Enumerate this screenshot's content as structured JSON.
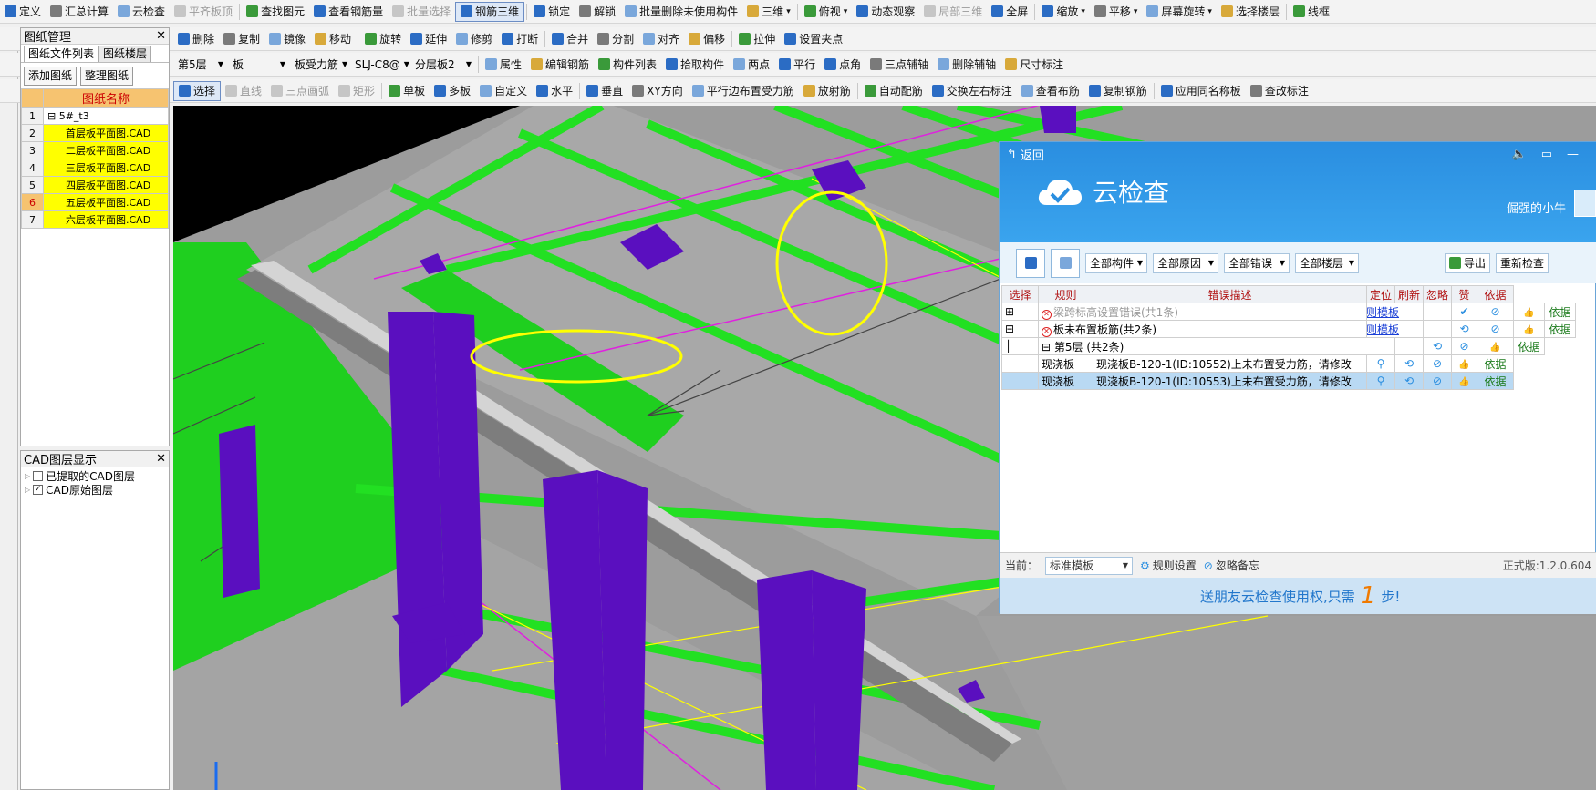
{
  "toolbar1": {
    "items": [
      {
        "icon": "define-icon",
        "label": "定义",
        "dis": false
      },
      {
        "icon": "sigma-icon",
        "label": "汇总计算",
        "dis": false
      },
      {
        "icon": "cloud-check-icon",
        "label": "云检查",
        "dis": false
      },
      {
        "icon": "align-top-icon",
        "label": "平齐板顶",
        "dis": true
      },
      {
        "icon": "binocular-icon",
        "label": "查找图元",
        "dis": false
      },
      {
        "icon": "view-rebar-icon",
        "label": "查看钢筋量",
        "dis": false
      },
      {
        "icon": "batch-select-icon",
        "label": "批量选择",
        "dis": true
      },
      {
        "icon": "rebar-3d-icon",
        "label": "钢筋三维",
        "dis": false,
        "on": true
      },
      {
        "icon": "lock-icon",
        "label": "锁定",
        "dis": false
      },
      {
        "icon": "unlock-icon",
        "label": "解锁",
        "dis": false
      },
      {
        "icon": "batch-delete-icon",
        "label": "批量删除未使用构件",
        "dis": false
      },
      {
        "icon": "3d-icon",
        "label": "三维",
        "dis": false,
        "caret": true
      },
      {
        "icon": "top-view-icon",
        "label": "俯视",
        "dis": false,
        "caret": true
      },
      {
        "icon": "orbit-icon",
        "label": "动态观察",
        "dis": false
      },
      {
        "icon": "local-3d-icon",
        "label": "局部三维",
        "dis": true
      },
      {
        "icon": "zoom-all-icon",
        "label": "全屏",
        "dis": false
      },
      {
        "icon": "zoom-icon",
        "label": "缩放",
        "dis": false,
        "caret": true
      },
      {
        "icon": "pan-icon",
        "label": "平移",
        "dis": false,
        "caret": true
      },
      {
        "icon": "rotate-screen-icon",
        "label": "屏幕旋转",
        "dis": false,
        "caret": true
      },
      {
        "icon": "select-floor-icon",
        "label": "选择楼层",
        "dis": false
      },
      {
        "icon": "wireframe-icon",
        "label": "线框",
        "dis": false
      }
    ]
  },
  "toolbar2": {
    "items": [
      {
        "icon": "delete-icon",
        "label": "删除"
      },
      {
        "icon": "copy-icon",
        "label": "复制"
      },
      {
        "icon": "mirror-icon",
        "label": "镜像"
      },
      {
        "icon": "move-icon",
        "label": "移动"
      },
      {
        "icon": "rotate-icon",
        "label": "旋转"
      },
      {
        "icon": "extend-icon",
        "label": "延伸"
      },
      {
        "icon": "trim-icon",
        "label": "修剪"
      },
      {
        "icon": "break-icon",
        "label": "打断"
      },
      {
        "icon": "merge-icon",
        "label": "合并"
      },
      {
        "icon": "split-icon",
        "label": "分割"
      },
      {
        "icon": "align-icon",
        "label": "对齐"
      },
      {
        "icon": "offset-icon",
        "label": "偏移"
      },
      {
        "icon": "stretch-icon",
        "label": "拉伸"
      },
      {
        "icon": "grip-icon",
        "label": "设置夹点"
      }
    ]
  },
  "toolbar3": {
    "selects": [
      "第5层",
      "板",
      "板受力筋",
      "SLJ-C8@",
      "分层板2"
    ],
    "items": [
      {
        "icon": "property-icon",
        "label": "属性"
      },
      {
        "icon": "edit-rebar-icon",
        "label": "编辑钢筋"
      },
      {
        "icon": "component-list-icon",
        "label": "构件列表"
      },
      {
        "icon": "pick-component-icon",
        "label": "拾取构件"
      },
      {
        "icon": "two-point-icon",
        "label": "两点"
      },
      {
        "icon": "parallel-icon",
        "label": "平行"
      },
      {
        "icon": "point-angle-icon",
        "label": "点角"
      },
      {
        "icon": "three-point-aux-icon",
        "label": "三点辅轴"
      },
      {
        "icon": "delete-aux-icon",
        "label": "删除辅轴"
      },
      {
        "icon": "dimension-icon",
        "label": "尺寸标注"
      }
    ]
  },
  "toolbar4": {
    "items": [
      {
        "icon": "select-icon",
        "label": "选择",
        "on": true
      },
      {
        "icon": "line-icon",
        "label": "直线",
        "dis": true
      },
      {
        "icon": "arc-icon",
        "label": "三点画弧",
        "dis": true
      },
      {
        "icon": "rect-icon",
        "label": "矩形",
        "dis": true
      },
      {
        "icon": "single-slab-icon",
        "label": "单板"
      },
      {
        "icon": "multi-slab-icon",
        "label": "多板"
      },
      {
        "icon": "custom-icon",
        "label": "自定义"
      },
      {
        "icon": "horizontal-icon",
        "label": "水平"
      },
      {
        "icon": "vertical-icon",
        "label": "垂直"
      },
      {
        "icon": "xy-direction-icon",
        "label": "XY方向"
      },
      {
        "icon": "parallel-edge-icon",
        "label": "平行边布置受力筋"
      },
      {
        "icon": "radial-icon",
        "label": "放射筋"
      },
      {
        "icon": "auto-rebar-icon",
        "label": "自动配筋"
      },
      {
        "icon": "swap-label-icon",
        "label": "交换左右标注"
      },
      {
        "icon": "view-layout-icon",
        "label": "查看布筋"
      },
      {
        "icon": "copy-rebar-icon",
        "label": "复制钢筋"
      },
      {
        "icon": "apply-same-icon",
        "label": "应用同名称板"
      },
      {
        "icon": "check-label-icon",
        "label": "查改标注"
      }
    ]
  },
  "drawing_panel": {
    "title": "图纸管理",
    "tabs": [
      "图纸文件列表",
      "图纸楼层"
    ],
    "add_btn": "添加图纸",
    "arrange_btn": "整理图纸",
    "col_header": "图纸名称",
    "rows": [
      {
        "n": "1",
        "name": "5#_t3",
        "yellow": false
      },
      {
        "n": "2",
        "name": "首层板平面图.CAD",
        "yellow": true
      },
      {
        "n": "3",
        "name": "二层板平面图.CAD",
        "yellow": true
      },
      {
        "n": "4",
        "name": "三层板平面图.CAD",
        "yellow": true
      },
      {
        "n": "5",
        "name": "四层板平面图.CAD",
        "yellow": true
      },
      {
        "n": "6",
        "name": "五层板平面图.CAD",
        "yellow": true
      },
      {
        "n": "7",
        "name": "六层板平面图.CAD",
        "yellow": true
      }
    ]
  },
  "layer_panel": {
    "title": "CAD图层显示",
    "items": [
      {
        "label": "已提取的CAD图层",
        "checked": false
      },
      {
        "label": "CAD原始图层",
        "checked": true
      }
    ]
  },
  "cloud": {
    "back": "返回",
    "title": "云检查",
    "user": "倔强的小牛",
    "filters": [
      "全部构件",
      "全部原因",
      "全部错误",
      "全部楼层"
    ],
    "export": "导出",
    "recheck": "重新检查",
    "headers": [
      "选择",
      "规则",
      "错误描述",
      "定位",
      "刷新",
      "忽略",
      "赞",
      "依据"
    ],
    "rows": [
      {
        "kind": "group",
        "expand": "+",
        "text": "梁跨标高设置错误(共1条)",
        "muted": true,
        "link": "修改规则模板",
        "basis": "依据"
      },
      {
        "kind": "group",
        "expand": "−",
        "text": "板未布置板筋(共2条)",
        "muted": false,
        "link": "修改规则模板",
        "basis": "依据"
      },
      {
        "kind": "floor",
        "expand": "−",
        "text": "第5层 (共2条)",
        "basis": "依据"
      },
      {
        "kind": "item",
        "rule": "现浇板",
        "desc": "现浇板B-120-1(ID:10552)上未布置受力筋，请修改",
        "basis": "依据",
        "selected": false
      },
      {
        "kind": "item",
        "rule": "现浇板",
        "desc": "现浇板B-120-1(ID:10553)上未布置受力筋，请修改",
        "basis": "依据",
        "selected": true
      }
    ],
    "footer": {
      "current_label": "当前：",
      "template": "标准模板",
      "rule_settings": "规则设置",
      "ignore_memo": "忽略备忘",
      "version": "正式版:1.2.0.604"
    },
    "banner_pre": "送朋友云检查使用权,只需",
    "banner_num": "1",
    "banner_post": "步!"
  },
  "colors": {
    "accent": "#2b8de0",
    "slab": "#9c9c9c",
    "rebar": "#22e022",
    "beam": "#5a0fbf",
    "highlight": "#ffff00"
  }
}
